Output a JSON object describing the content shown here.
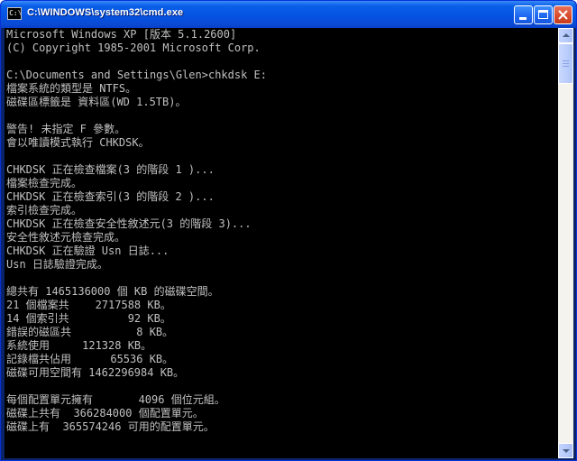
{
  "window": {
    "title": "C:\\WINDOWS\\system32\\cmd.exe",
    "icon": "cmd-icon",
    "icon_label": "C:\\",
    "title_bar_color": "#0a5fe8",
    "close_color": "#d84a2b"
  },
  "console": {
    "background": "#000000",
    "foreground": "#c0c0c0",
    "lines": [
      "Microsoft Windows XP [版本 5.1.2600]",
      "(C) Copyright 1985-2001 Microsoft Corp.",
      "",
      "C:\\Documents and Settings\\Glen>chkdsk E:",
      "檔案系統的類型是 NTFS。",
      "磁碟區標籤是 資料區(WD 1.5TB)。",
      "",
      "警告! 未指定 F 參數。",
      "會以唯讀模式執行 CHKDSK。",
      "",
      "CHKDSK 正在檢查檔案(3 的階段 1 )...",
      "檔案檢查完成。",
      "CHKDSK 正在檢查索引(3 的階段 2 )...",
      "索引檢查完成。",
      "CHKDSK 正在檢查安全性敘述元(3 的階段 3)...",
      "安全性敘述元檢查完成。",
      "CHKDSK 正在驗證 Usn 日誌...",
      "Usn 日誌驗證完成。",
      "",
      "總共有 1465136000 個 KB 的磁碟空間。",
      "21 個檔案共    2717588 KB。",
      "14 個索引共         92 KB。",
      "錯誤的磁區共          8 KB。",
      "系統使用     121328 KB。",
      "記錄檔共佔用      65536 KB。",
      "磁碟可用空間有 1462296984 KB。",
      "",
      "每個配置單元擁有       4096 個位元組。",
      "磁碟上共有  366284000 個配置單元。",
      "磁碟上有  365574246 可用的配置單元。"
    ]
  }
}
